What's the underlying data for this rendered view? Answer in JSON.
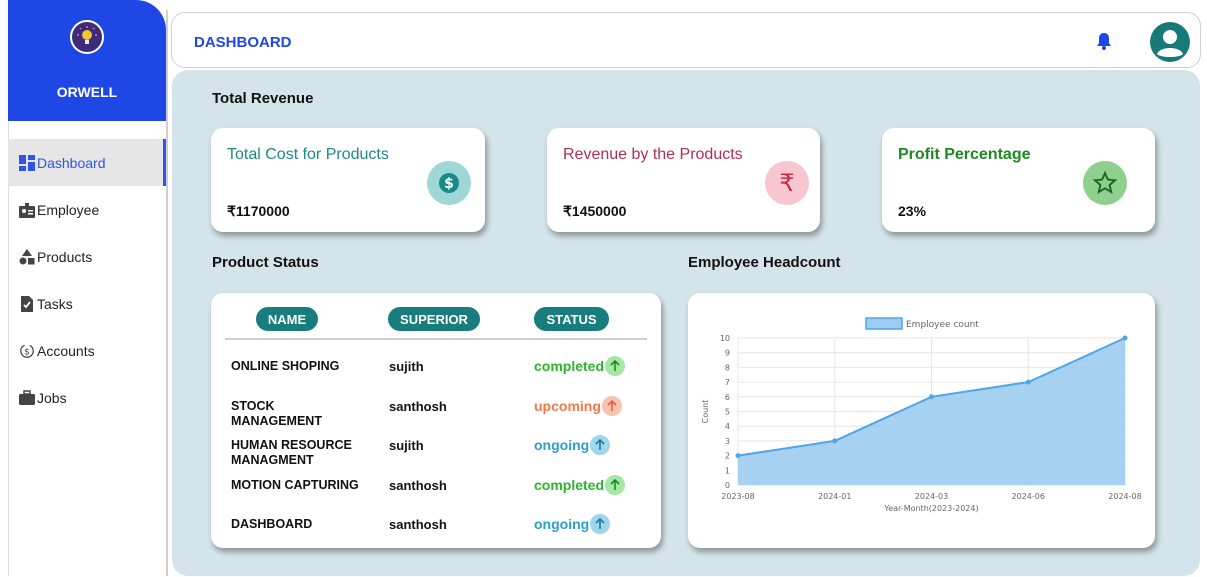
{
  "brand": {
    "name": "ORWELL"
  },
  "header": {
    "title": "DASHBOARD"
  },
  "sidebar": {
    "items": [
      {
        "label": "Dashboard",
        "icon": "dashboard-icon",
        "active": true
      },
      {
        "label": "Employee",
        "icon": "employee-icon",
        "active": false
      },
      {
        "label": "Products",
        "icon": "products-icon",
        "active": false
      },
      {
        "label": "Tasks",
        "icon": "tasks-icon",
        "active": false
      },
      {
        "label": "Accounts",
        "icon": "accounts-icon",
        "active": false
      },
      {
        "label": "Jobs",
        "icon": "jobs-icon",
        "active": false
      }
    ]
  },
  "sections": {
    "revenue": "Total Revenue",
    "product_status": "Product Status",
    "headcount": "Employee Headcount"
  },
  "kpis": [
    {
      "title": "Total Cost for Products",
      "value": "₹1170000",
      "icon": "dollar-icon",
      "title_color": "#1a8a87",
      "icon_bg": "#9fd6d6",
      "icon_fg": "#1a8a87"
    },
    {
      "title": "Revenue by the Products",
      "value": "₹1450000",
      "icon": "rupee-icon",
      "title_color": "#b0304a",
      "icon_bg": "#f8c6cf",
      "icon_fg": "#c0304a"
    },
    {
      "title": "Profit Percentage",
      "value": "23%",
      "icon": "star-icon",
      "title_color": "#1d8a22",
      "icon_bg": "#8fd08f",
      "icon_fg": "#1a6d1a"
    }
  ],
  "table": {
    "headers": [
      "NAME",
      "SUPERIOR",
      "STATUS"
    ],
    "rows": [
      {
        "name": "ONLINE SHOPING",
        "superior": "sujith",
        "status": "completed",
        "status_color": "#2bb52b",
        "badge_bg": "#a6e6a6"
      },
      {
        "name": "STOCK MANAGEMENT",
        "superior": "santhosh",
        "status": "upcoming",
        "status_color": "#f07a46",
        "badge_bg": "#f8c3b1"
      },
      {
        "name": "HUMAN RESOURCE MANAGMENT",
        "superior": "sujith",
        "status": "ongoing",
        "status_color": "#2aa0c8",
        "badge_bg": "#9fd6ea"
      },
      {
        "name": "MOTION CAPTURING",
        "superior": "santhosh",
        "status": "completed",
        "status_color": "#2bb52b",
        "badge_bg": "#a6e6a6"
      },
      {
        "name": "DASHBOARD",
        "superior": "santhosh",
        "status": "ongoing",
        "status_color": "#2aa0c8",
        "badge_bg": "#9fd6ea"
      }
    ]
  },
  "chart_data": {
    "type": "area",
    "categories": [
      "2023-08",
      "2024-01",
      "2024-03",
      "2024-06",
      "2024-08"
    ],
    "series": [
      {
        "name": "Employee count",
        "values": [
          2,
          3,
          6,
          7,
          10
        ]
      }
    ],
    "xlabel": "Year-Month(2023-2024)",
    "ylabel": "Count",
    "ylim": [
      0,
      10
    ],
    "yticks": [
      0,
      1,
      2,
      3,
      4,
      5,
      6,
      7,
      8,
      9,
      10
    ],
    "grid": true,
    "legend": "top",
    "colors": {
      "line": "#4fa6e6",
      "fill": "#9cccef"
    }
  }
}
